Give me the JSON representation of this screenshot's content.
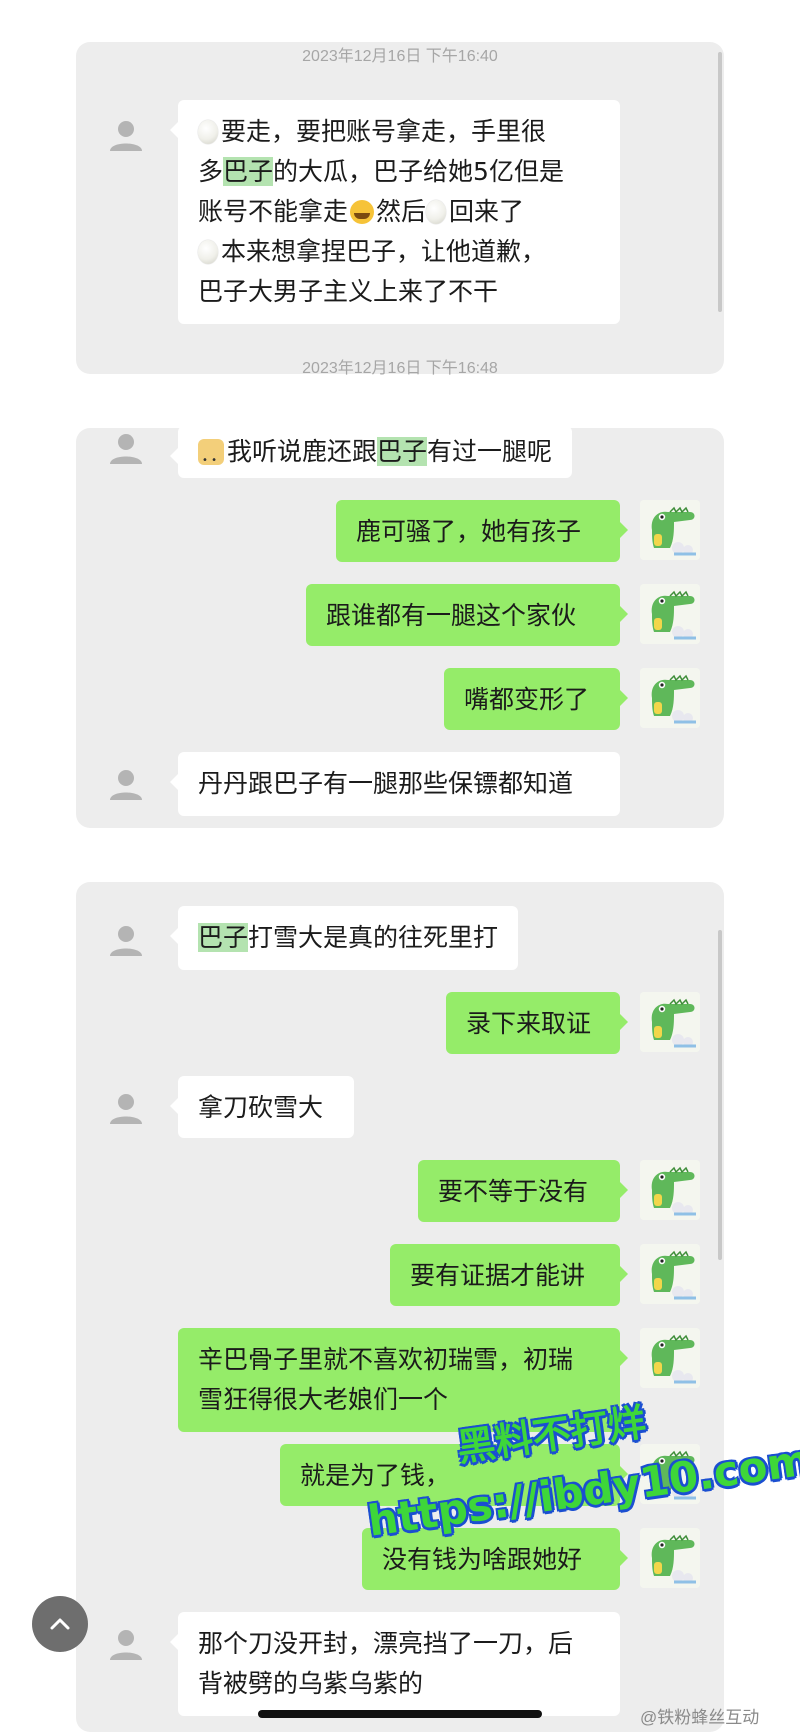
{
  "timestamps": [
    "2023年12月16日 下午16:40",
    "2023年12月16日 下午16:48"
  ],
  "messages": {
    "m1": {
      "l1a": "要走，要把账号拿走，手里很",
      "l2a": "多",
      "l2b": "巴子",
      "l2c": "的大瓜，巴子给她5亿但是",
      "l3a": "账号不能拿走",
      "l3b": "然后",
      "l3c": "回来了",
      "l4a": "本来想拿捏巴子，让他道歉，",
      "l5a": "巴子大男子主义上来了不干"
    },
    "m2": {
      "a": "我听说鹿还跟",
      "b": "巴子",
      "c": "有过一腿呢"
    },
    "m3": "鹿可骚了，她有孩子",
    "m4": "跟谁都有一腿这个家伙",
    "m5": "嘴都变形了",
    "m6": "丹丹跟巴子有一腿那些保镖都知道",
    "m7": {
      "a": "巴子",
      "b": "打雪大是真的往死里打"
    },
    "m8": "录下来取证",
    "m9": "拿刀砍雪大",
    "m10": "要不等于没有",
    "m11": "要有证据才能讲",
    "m12": {
      "l1": "辛巴骨子里就不喜欢初瑞雪，初瑞",
      "l2": "雪狂得很大老娘们一个"
    },
    "m13": "就是为了钱，",
    "m14": "没有钱为啥跟她好",
    "m15": {
      "l1": "那个刀没开封，漂亮挡了一刀，后",
      "l2": "背被劈的乌紫乌紫的"
    }
  },
  "watermark": {
    "line1": "黑料不打烊",
    "line2": "https://ibdy10.com"
  },
  "credit": "@铁粉蜂丝互动",
  "colors": {
    "incoming_bubble": "#ffffff",
    "outgoing_bubble": "#95ec69",
    "highlight": "#b4e3b0",
    "panel": "#ededed"
  }
}
